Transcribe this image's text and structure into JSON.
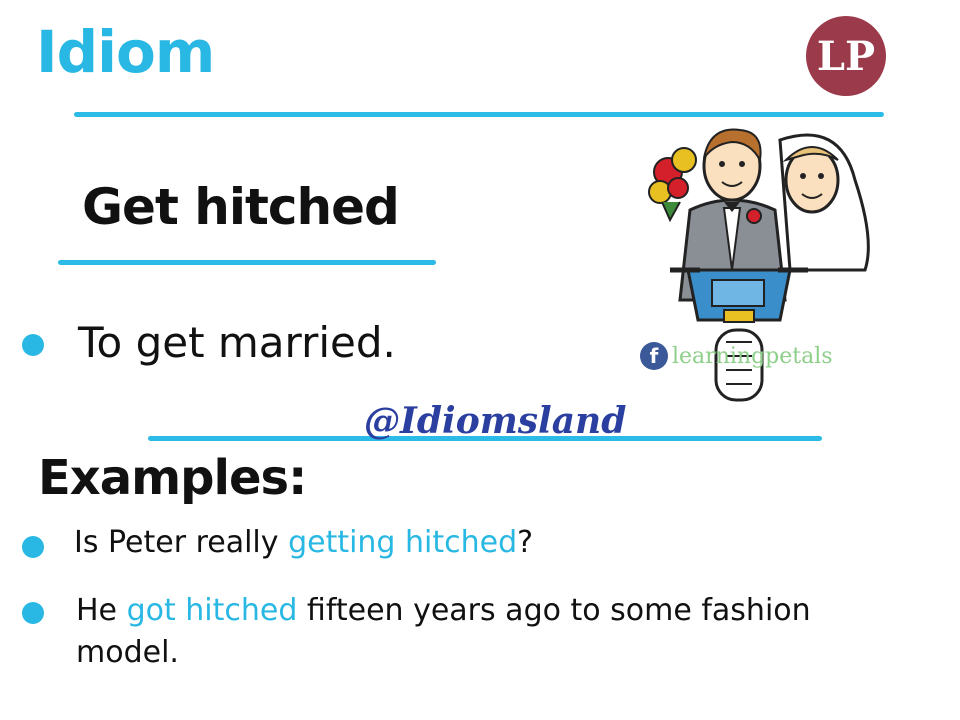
{
  "header": {
    "title": "Idiom",
    "logo_text": "LP"
  },
  "idiom": {
    "phrase": "Get hitched",
    "meaning": "To get married."
  },
  "watermark": {
    "handle": "@Idiomsland",
    "fb_glyph": "f",
    "fb_page": "learningpetals"
  },
  "examples": {
    "heading": "Examples:",
    "items": [
      {
        "before": "Is Peter really ",
        "highlight": "getting hitched",
        "after": "?"
      },
      {
        "before": "He ",
        "highlight": "got hitched",
        "after": " fifteen years ago to some fashion",
        "after2": "model."
      }
    ]
  },
  "illustration": {
    "description_icon": "bride-groom-scooter-icon"
  },
  "colors": {
    "accent": "#29b8e3",
    "rule": "#2bbbe6",
    "logo_bg": "#9b3a4a",
    "watermark": "#2b3fa0",
    "fb_blue": "#3b5998",
    "fb_text": "#8ecf8a"
  }
}
